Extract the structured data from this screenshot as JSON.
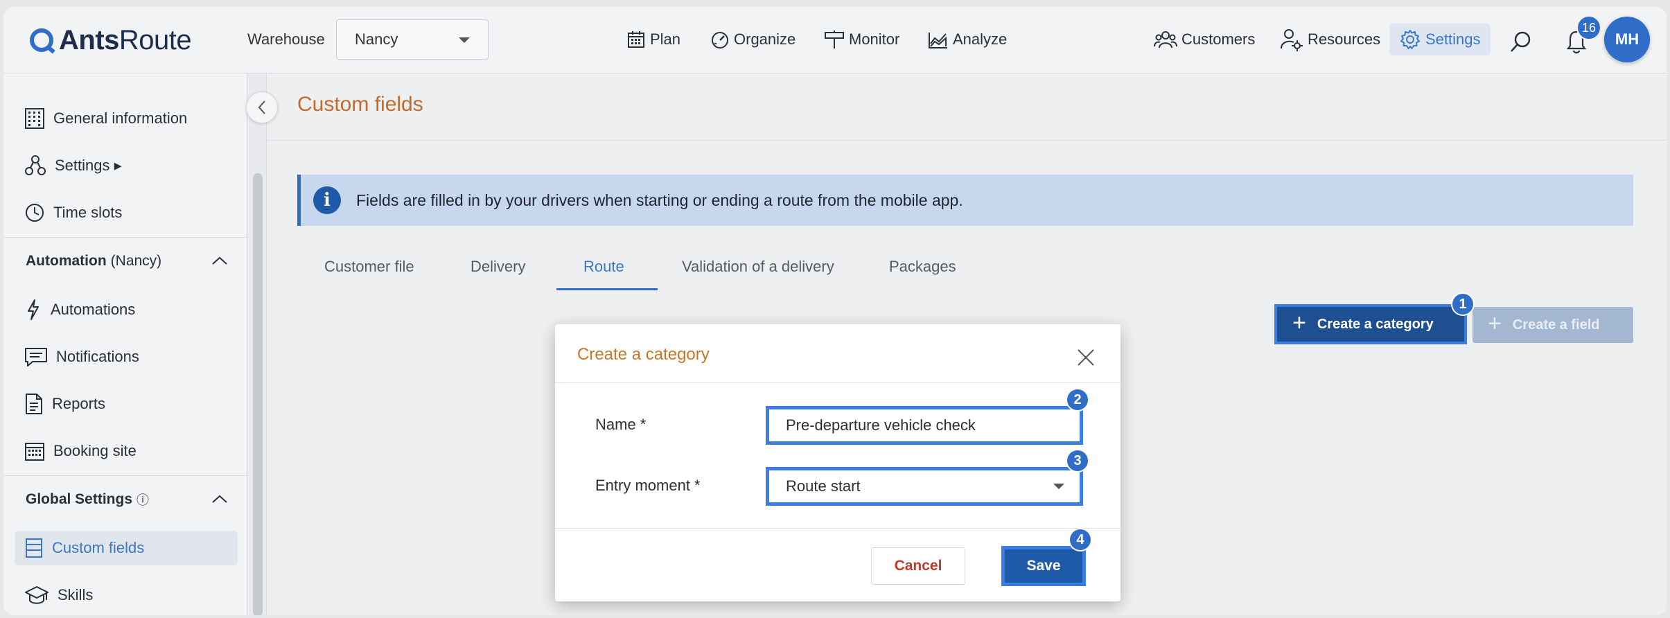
{
  "app": {
    "logo_bold": "Ants",
    "logo_light": "Route"
  },
  "topbar": {
    "warehouse_label": "Warehouse",
    "warehouse_value": "Nancy",
    "nav": [
      {
        "label": "Plan",
        "icon": "calendar-icon"
      },
      {
        "label": "Organize",
        "icon": "gauge-icon"
      },
      {
        "label": "Monitor",
        "icon": "signpost-icon"
      },
      {
        "label": "Analyze",
        "icon": "chart-area-icon"
      }
    ],
    "right_nav": [
      {
        "label": "Customers",
        "icon": "users-icon"
      },
      {
        "label": "Resources",
        "icon": "user-gear-icon"
      },
      {
        "label": "Settings",
        "icon": "gear-icon",
        "active": true
      }
    ],
    "notifications_count": "16",
    "avatar_initials": "MH"
  },
  "sidebar": {
    "items_top": [
      {
        "label": "General information",
        "icon": "building-icon"
      },
      {
        "label": "Settings ▸",
        "icon": "nodes-icon"
      },
      {
        "label": "Time slots",
        "icon": "clock-icon"
      }
    ],
    "automation_section": {
      "title": "Automation",
      "suffix": "(Nancy)"
    },
    "automation_items": [
      {
        "label": "Automations",
        "icon": "bolt-icon"
      },
      {
        "label": "Notifications",
        "icon": "message-icon"
      },
      {
        "label": "Reports",
        "icon": "document-icon"
      },
      {
        "label": "Booking site",
        "icon": "calendar-grid-icon"
      }
    ],
    "global_section": {
      "title": "Global Settings",
      "info": "ⓘ"
    },
    "global_items": [
      {
        "label": "Custom fields",
        "icon": "list-icon",
        "active": true
      },
      {
        "label": "Skills",
        "icon": "graduation-cap-icon"
      }
    ]
  },
  "main": {
    "page_title": "Custom fields",
    "info_text": "Fields are filled in by your drivers when starting or ending a route from the mobile app.",
    "tabs": [
      "Customer file",
      "Delivery",
      "Route",
      "Validation of a delivery",
      "Packages"
    ],
    "active_tab": "Route",
    "create_category_label": "Create a category",
    "create_field_label": "Create a field"
  },
  "modal": {
    "title": "Create a category",
    "name_label": "Name *",
    "name_value": "Pre-departure vehicle check",
    "entry_label": "Entry moment *",
    "entry_value": "Route start",
    "cancel_label": "Cancel",
    "save_label": "Save"
  },
  "steps": [
    "1",
    "2",
    "3",
    "4"
  ],
  "colors": {
    "accent": "#2f6dc9",
    "title_orange": "#c56a2f",
    "highlight_border": "#3b7de0",
    "cancel_red": "#c0392b"
  }
}
